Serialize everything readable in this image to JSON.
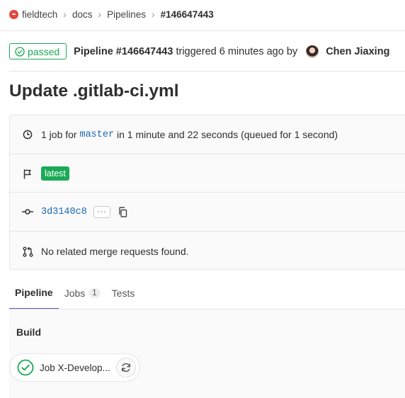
{
  "breadcrumbs": {
    "group": "fieldtech",
    "project": "docs",
    "section": "Pipelines",
    "current": "#146647443"
  },
  "header": {
    "status_label": "passed",
    "pipeline_label": "Pipeline #146647443",
    "triggered_text": " triggered 6 minutes ago by ",
    "author": "Chen Jiaxing"
  },
  "title": "Update .gitlab-ci.yml",
  "info": {
    "jobs_prefix": "1 job for ",
    "branch": "master",
    "jobs_suffix": " in 1 minute and 22 seconds (queued for 1 second)",
    "tag": "latest",
    "commit_sha": "3d3140c8",
    "ellipsis": "···",
    "merge_requests": "No related merge requests found."
  },
  "tabs": [
    {
      "label": "Pipeline"
    },
    {
      "label": "Jobs",
      "count": "1"
    },
    {
      "label": "Tests"
    }
  ],
  "stage": {
    "name": "Build",
    "job_name": "Job X-Develop..."
  },
  "colors": {
    "success": "#1aaa55",
    "link": "#1b69b6",
    "tab_active": "#6b4fbb"
  },
  "icons": [
    "clock-icon",
    "flag-icon",
    "commit-icon",
    "copy-icon",
    "merge-request-icon",
    "check-circle-icon",
    "retry-icon"
  ]
}
